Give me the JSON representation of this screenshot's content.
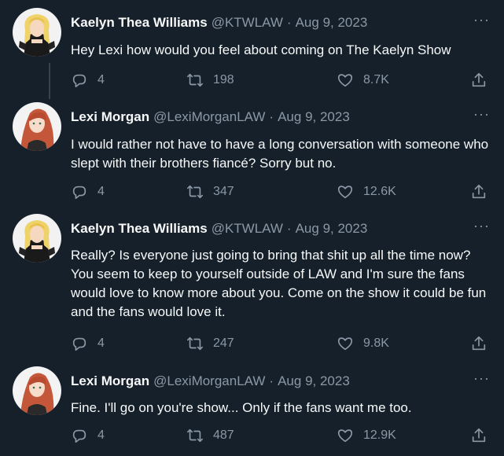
{
  "tweets": [
    {
      "name": "Kaelyn Thea Williams",
      "handle": "@KTWLAW",
      "separator": "·",
      "date": "Aug 9, 2023",
      "text": "Hey Lexi how would you feel about coming on The Kaelyn Show",
      "replies": "4",
      "retweets": "198",
      "likes": "8.7K",
      "avatar": "blonde-wrestler"
    },
    {
      "name": "Lexi Morgan",
      "handle": "@LexiMorganLAW",
      "separator": "·",
      "date": "Aug 9, 2023",
      "text": "I would rather not have to have a long conversation with someone who slept with their brothers fiancé? Sorry but no.",
      "replies": "4",
      "retweets": "347",
      "likes": "12.6K",
      "avatar": "redhead"
    },
    {
      "name": "Kaelyn Thea Williams",
      "handle": "@KTWLAW",
      "separator": "·",
      "date": "Aug 9, 2023",
      "text": "Really? Is everyone just going to bring that shit up all the time now? You seem to keep to yourself outside of LAW and I'm sure the fans would love to know more about you. Come on the show it could be fun and the fans would love it.",
      "replies": "4",
      "retweets": "247",
      "likes": "9.8K",
      "avatar": "blonde-wrestler"
    },
    {
      "name": "Lexi Morgan",
      "handle": "@LexiMorganLAW",
      "separator": "·",
      "date": "Aug 9, 2023",
      "text": "Fine. I'll go on you're show... Only if the fans want me too.",
      "replies": "4",
      "retweets": "487",
      "likes": "12.9K",
      "avatar": "redhead"
    }
  ],
  "more_icon": "···",
  "colors": {
    "background": "#15202b",
    "text": "#f7f9f9",
    "muted": "#8b98a5",
    "thread_line": "#38444d"
  }
}
